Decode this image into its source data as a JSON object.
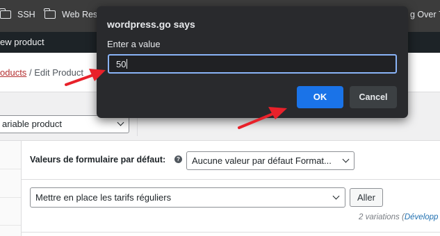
{
  "bookmarks": [
    {
      "label": "SSH",
      "icon": "folder-icon"
    },
    {
      "label": "Web Reso",
      "icon": "folder-icon"
    },
    {
      "label": "g Over 7.",
      "icon": ""
    }
  ],
  "adminbar": {
    "new_product": "ew product"
  },
  "breadcrumb": {
    "parent": "oducts",
    "separator": "/",
    "current": "Edit Product"
  },
  "product_type": {
    "selected": "ariable product"
  },
  "variations_panel": {
    "defaults_label": "Valeurs de formulaire par défaut:",
    "help_icon": "?",
    "defaults_select": "Aucune valeur par défaut Format...",
    "bulk_select": "Mettre en place les tarifs réguliers",
    "go_button": "Aller",
    "variations_count": "2 variations",
    "expand_link_prefix": "(",
    "expand_link": "Développ"
  },
  "dialog": {
    "title": "wordpress.go says",
    "message": "Enter a value",
    "input_value": "50",
    "ok_label": "OK",
    "cancel_label": "Cancel",
    "accent": "#1a73e8"
  },
  "annotations": {
    "arrow_color": "#e8212a"
  }
}
